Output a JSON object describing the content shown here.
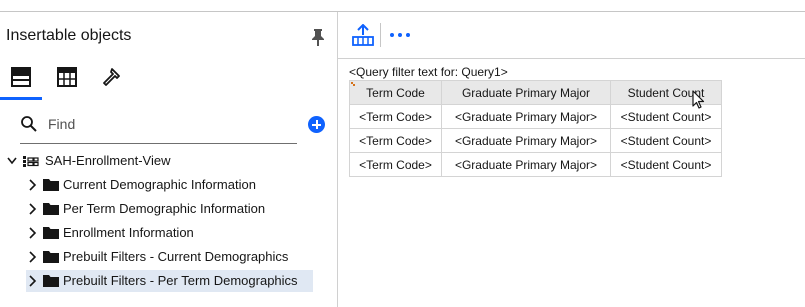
{
  "panel": {
    "title": "Insertable objects",
    "tabs": [
      {
        "name": "data-source-icon"
      },
      {
        "name": "toolbox-icon"
      },
      {
        "name": "hammer-icon"
      }
    ],
    "search_placeholder": "Find"
  },
  "tree": {
    "root": "SAH-Enrollment-View",
    "items": [
      {
        "label": "Current Demographic Information"
      },
      {
        "label": "Per Term Demographic Information"
      },
      {
        "label": "Enrollment Information"
      },
      {
        "label": "Prebuilt Filters - Current Demographics"
      },
      {
        "label": "Prebuilt Filters - Per Term Demographics",
        "selected": true
      }
    ]
  },
  "report": {
    "query_filter_text": "<Query filter text for: Query1>",
    "columns": [
      "Term Code",
      "Graduate Primary Major",
      "Student Count"
    ],
    "rows": [
      [
        "<Term Code>",
        "<Graduate Primary Major>",
        "<Student Count>"
      ],
      [
        "<Term Code>",
        "<Graduate Primary Major>",
        "<Student Count>"
      ],
      [
        "<Term Code>",
        "<Graduate Primary Major>",
        "<Student Count>"
      ]
    ]
  },
  "colors": {
    "accent": "#0f62fe",
    "header_bg": "#e8e8e8",
    "selected_row": "#e0e8f3"
  }
}
